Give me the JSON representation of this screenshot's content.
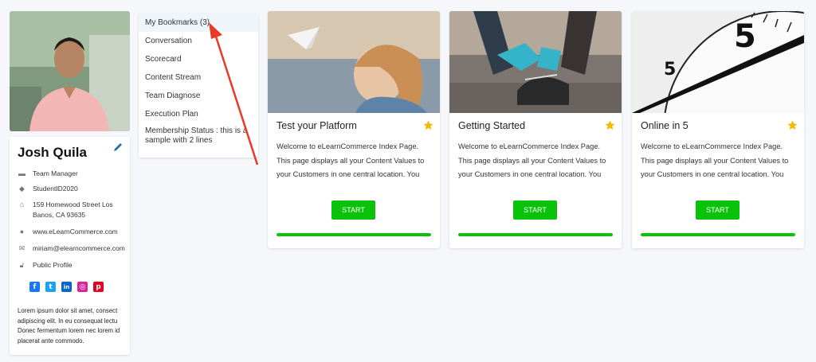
{
  "profile": {
    "name": "Josh Quila",
    "role": "Team Manager",
    "student_id": "StudentID2020",
    "address": "159 Homewood Street Los Banos, CA 93635",
    "website": "www.eLearnCommerce.com",
    "email": "miriam@elearncommerce.com",
    "visibility": "Public Profile",
    "socials": [
      "facebook-icon",
      "twitter-icon",
      "linkedin-icon",
      "instagram-icon",
      "pinterest-icon"
    ],
    "bio": "Lorem ipsum dolor sit amet, consect adipiscing elit. In eu consequat lectu Donec fermentum lorem nec lorem id placerat ante commodo."
  },
  "menu": {
    "items": [
      {
        "label": "My Bookmarks (3)"
      },
      {
        "label": "Conversation"
      },
      {
        "label": "Scorecard"
      },
      {
        "label": "Content Stream"
      },
      {
        "label": "Team Diagnose"
      },
      {
        "label": "Execution Plan"
      },
      {
        "label": "Membership Status : this is a sample with 2 lines"
      }
    ]
  },
  "courses": [
    {
      "title": "Test your Platform",
      "description": "Welcome to eLearnCommerce Index Page. This page displays all your Content Values to your Customers in one central location. You can create an unlimited",
      "button": "START",
      "progress": 1.0
    },
    {
      "title": "Getting Started",
      "description": "Welcome to eLearnCommerce Index Page. This page displays all your Content Values to your Customers in one central location. You can create an unlimited",
      "button": "START",
      "progress": 1.0
    },
    {
      "title": "Online in 5",
      "description": "Welcome to eLearnCommerce Index Page. This page displays all your Content Values to your Customers in one central location. You can create an unlimited",
      "button": "START",
      "progress": 1.0
    }
  ],
  "colors": {
    "accent_green": "#0ac20a",
    "star": "#f5b800",
    "annotation": "#e83a26"
  }
}
